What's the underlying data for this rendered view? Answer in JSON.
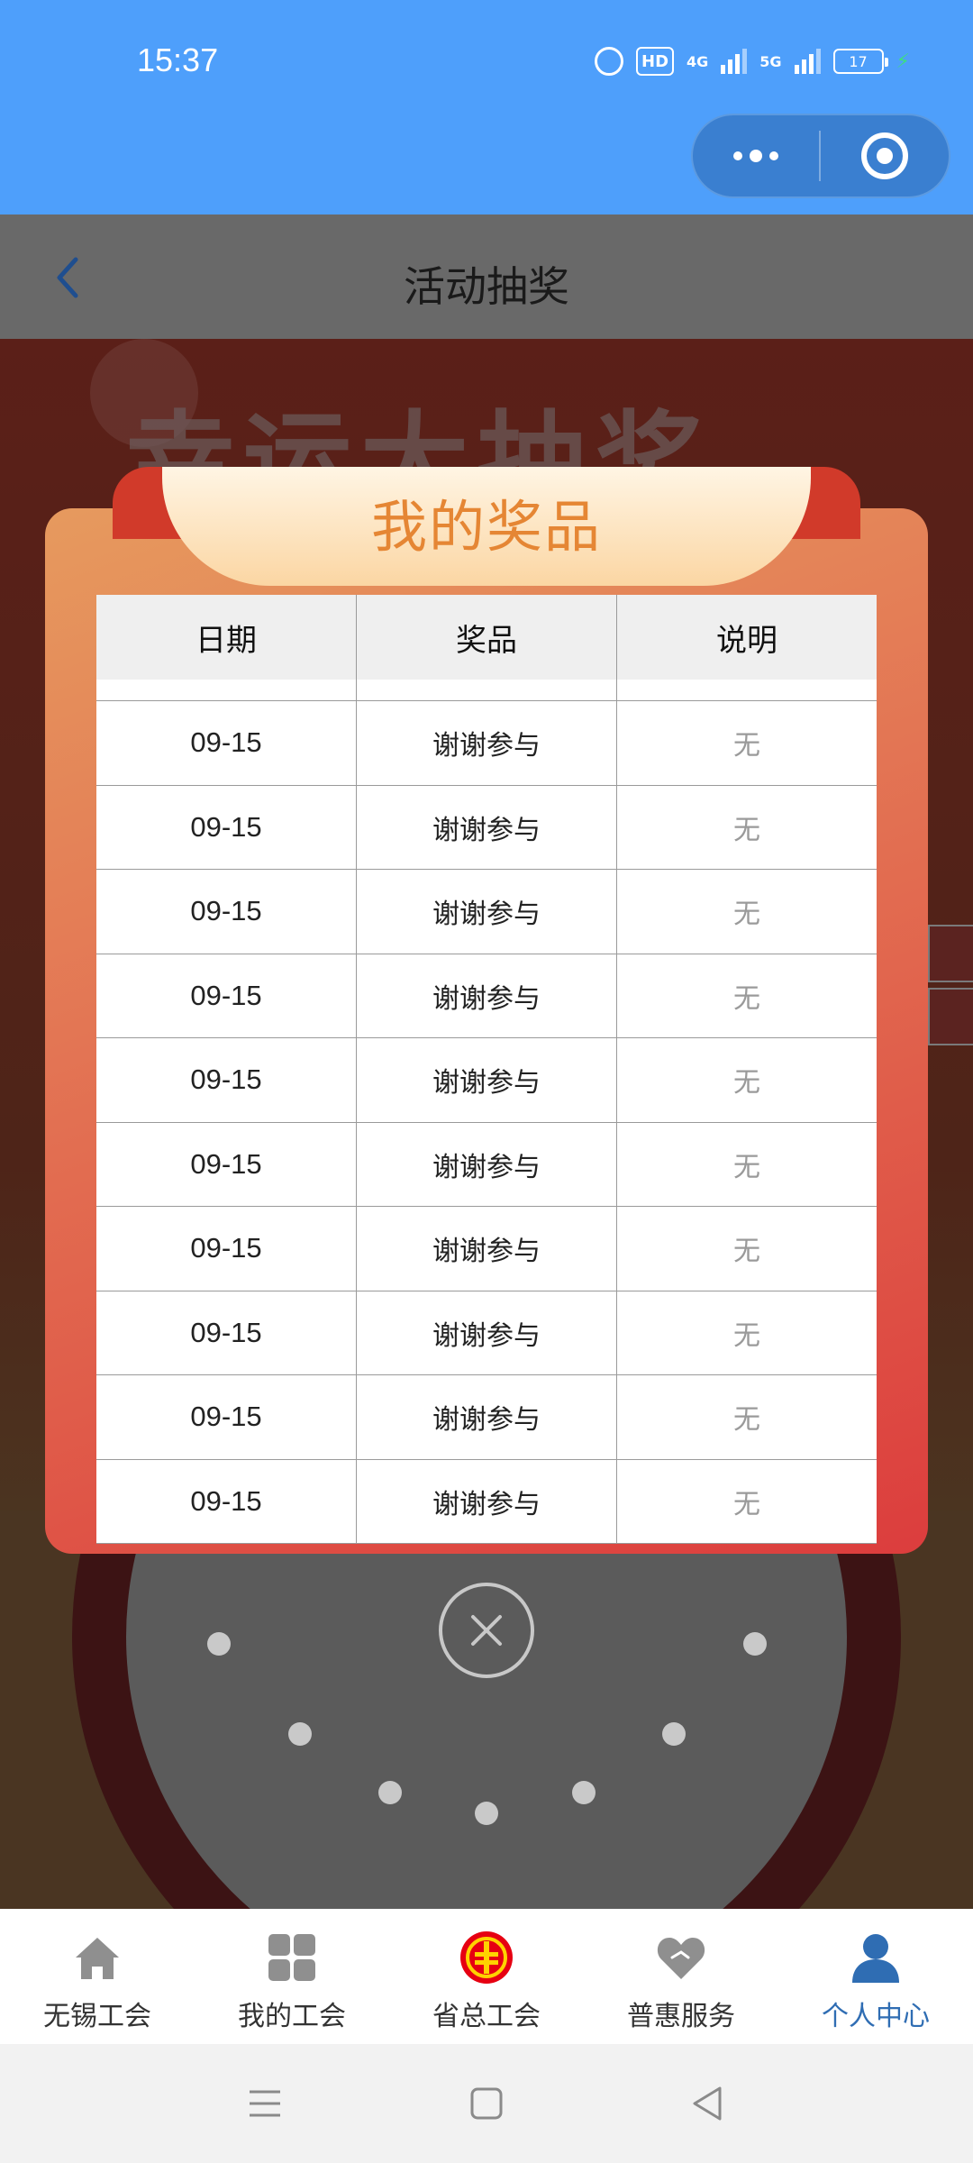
{
  "status_bar": {
    "time": "15:37",
    "hd": "HD",
    "net1": "4G",
    "net2": "5G",
    "battery": "17"
  },
  "nav": {
    "title": "活动抽奖"
  },
  "background": {
    "banner": "幸运大抽奖"
  },
  "modal": {
    "title": "我的奖品",
    "columns": [
      "日期",
      "奖品",
      "说明"
    ],
    "rows": [
      {
        "date": "09-15",
        "prize": "谢谢参与",
        "note": "无"
      },
      {
        "date": "09-15",
        "prize": "谢谢参与",
        "note": "无"
      },
      {
        "date": "09-15",
        "prize": "谢谢参与",
        "note": "无"
      },
      {
        "date": "09-15",
        "prize": "谢谢参与",
        "note": "无"
      },
      {
        "date": "09-15",
        "prize": "谢谢参与",
        "note": "无"
      },
      {
        "date": "09-15",
        "prize": "谢谢参与",
        "note": "无"
      },
      {
        "date": "09-15",
        "prize": "谢谢参与",
        "note": "无"
      },
      {
        "date": "09-15",
        "prize": "谢谢参与",
        "note": "无"
      },
      {
        "date": "09-15",
        "prize": "谢谢参与",
        "note": "无"
      },
      {
        "date": "09-15",
        "prize": "谢谢参与",
        "note": "无"
      }
    ]
  },
  "tab_bar": {
    "items": [
      {
        "label": "无锡工会",
        "icon": "home-icon"
      },
      {
        "label": "我的工会",
        "icon": "grid-icon"
      },
      {
        "label": "省总工会",
        "icon": "union-logo-icon"
      },
      {
        "label": "普惠服务",
        "icon": "heart-icon"
      },
      {
        "label": "个人中心",
        "icon": "person-icon"
      }
    ],
    "active_index": 4
  },
  "colors": {
    "status_bar_bg": "#4e9ffb",
    "modal_title": "#e58634",
    "active_tab": "#2f6db3"
  }
}
